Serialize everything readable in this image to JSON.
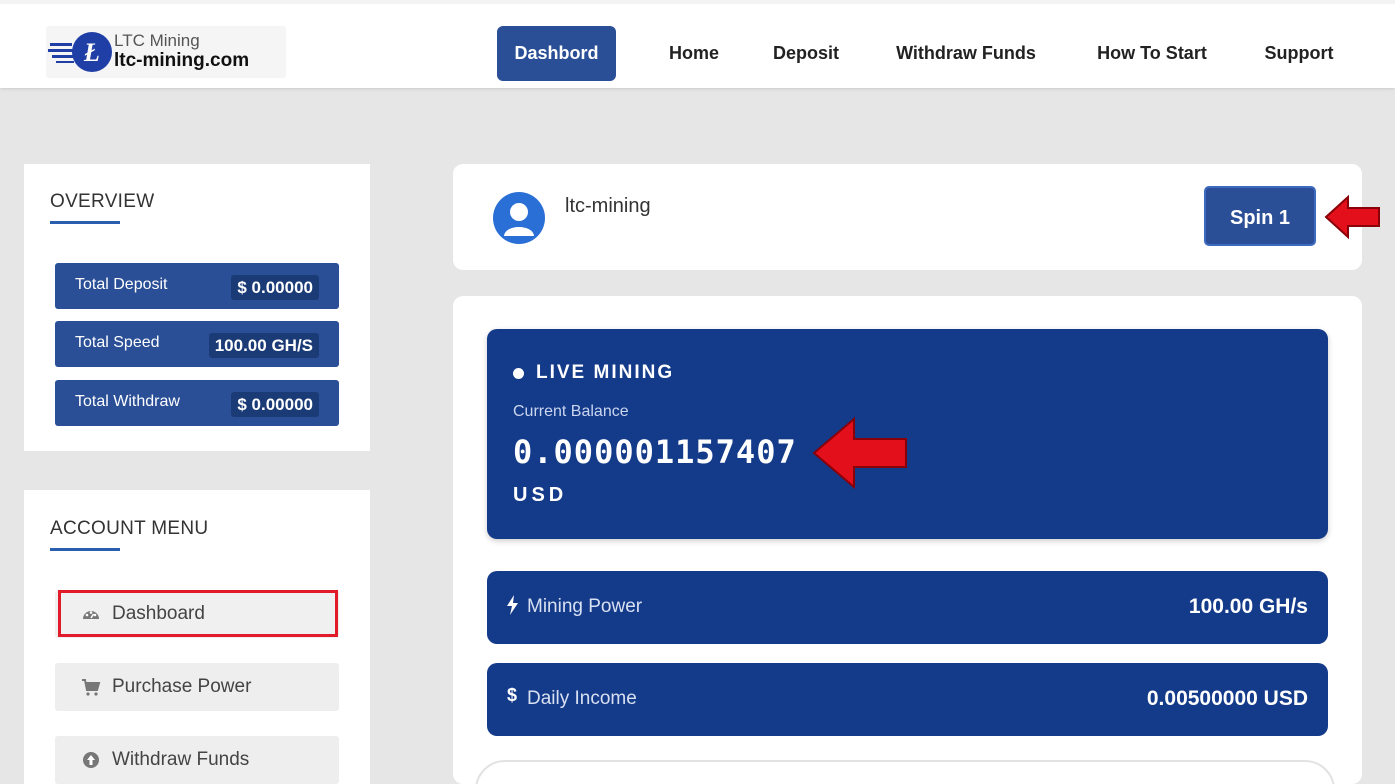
{
  "header": {
    "logo_small": "LTC Mining",
    "logo_big": "ltc-mining.com",
    "nav": [
      {
        "label": "Dashbord"
      },
      {
        "label": "Home"
      },
      {
        "label": "Deposit"
      },
      {
        "label": "Withdraw Funds"
      },
      {
        "label": "How To Start"
      },
      {
        "label": "Support"
      }
    ]
  },
  "overview": {
    "title": "OVERVIEW",
    "stats": [
      {
        "label": "Total Deposit",
        "value": "$ 0.00000"
      },
      {
        "label": "Total Speed",
        "value": "100.00 GH/S"
      },
      {
        "label": "Total Withdraw",
        "value": "$ 0.00000"
      }
    ]
  },
  "account_menu": {
    "title": "ACCOUNT MENU",
    "items": [
      {
        "label": "Dashboard",
        "icon": "gauge-icon"
      },
      {
        "label": "Purchase Power",
        "icon": "cart-icon"
      },
      {
        "label": "Withdraw Funds",
        "icon": "arrow-up-circle-icon"
      }
    ]
  },
  "user": {
    "name": "ltc-mining",
    "spin_label": "Spin 1"
  },
  "live": {
    "label": "LIVE MINING",
    "balance_label": "Current Balance",
    "balance": "0.000001157407",
    "unit": "USD"
  },
  "stats_rows": [
    {
      "icon": "bolt-icon",
      "label": "Mining Power",
      "value": "100.00 GH/s"
    },
    {
      "icon": "dollar-icon",
      "label": "Daily Income",
      "value": "0.00500000 USD"
    }
  ],
  "colors": {
    "brand": "#2a4f96",
    "card": "#143a8a",
    "highlight": "#e21b2a"
  }
}
